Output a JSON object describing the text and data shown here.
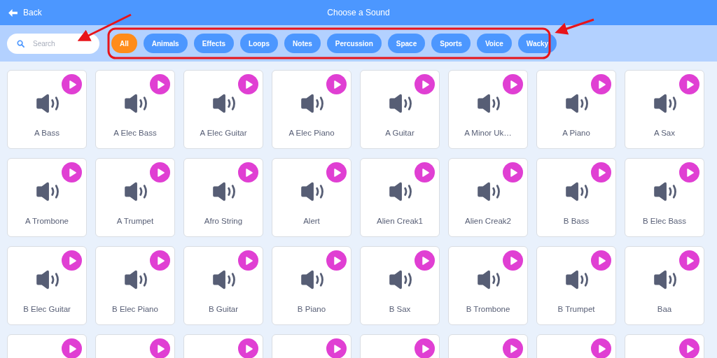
{
  "header": {
    "back": "Back",
    "title": "Choose a Sound"
  },
  "search": {
    "placeholder": "Search"
  },
  "filters": [
    {
      "label": "All",
      "selected": true
    },
    {
      "label": "Animals",
      "selected": false
    },
    {
      "label": "Effects",
      "selected": false
    },
    {
      "label": "Loops",
      "selected": false
    },
    {
      "label": "Notes",
      "selected": false
    },
    {
      "label": "Percussion",
      "selected": false
    },
    {
      "label": "Space",
      "selected": false
    },
    {
      "label": "Sports",
      "selected": false
    },
    {
      "label": "Voice",
      "selected": false
    },
    {
      "label": "Wacky",
      "selected": false
    }
  ],
  "sounds": [
    {
      "kind": "sound",
      "name": "A Bass"
    },
    {
      "kind": "sound",
      "name": "A Elec Bass"
    },
    {
      "kind": "sound",
      "name": "A Elec Guitar"
    },
    {
      "kind": "sound",
      "name": "A Elec Piano"
    },
    {
      "kind": "sound",
      "name": "A Guitar"
    },
    {
      "kind": "sound",
      "name": "A Minor Uk…"
    },
    {
      "kind": "sound",
      "name": "A Piano"
    },
    {
      "kind": "sound",
      "name": "A Sax"
    },
    {
      "kind": "sound",
      "name": "A Trombone"
    },
    {
      "kind": "sound",
      "name": "A Trumpet"
    },
    {
      "kind": "sound",
      "name": "Afro String"
    },
    {
      "kind": "sound",
      "name": "Alert"
    },
    {
      "kind": "sound",
      "name": "Alien Creak1"
    },
    {
      "kind": "sound",
      "name": "Alien Creak2"
    },
    {
      "kind": "sound",
      "name": "B Bass"
    },
    {
      "kind": "sound",
      "name": "B Elec Bass"
    },
    {
      "kind": "sound",
      "name": "B Elec Guitar"
    },
    {
      "kind": "sound",
      "name": "B Elec Piano"
    },
    {
      "kind": "sound",
      "name": "B Guitar"
    },
    {
      "kind": "sound",
      "name": "B Piano"
    },
    {
      "kind": "sound",
      "name": "B Sax"
    },
    {
      "kind": "sound",
      "name": "B Trombone"
    },
    {
      "kind": "sound",
      "name": "B Trumpet"
    },
    {
      "kind": "sound",
      "name": "Baa"
    },
    {
      "kind": "cut"
    },
    {
      "kind": "cut"
    },
    {
      "kind": "cut"
    },
    {
      "kind": "cut"
    },
    {
      "kind": "cut"
    },
    {
      "kind": "cut"
    },
    {
      "kind": "cut"
    },
    {
      "kind": "cut"
    }
  ]
}
